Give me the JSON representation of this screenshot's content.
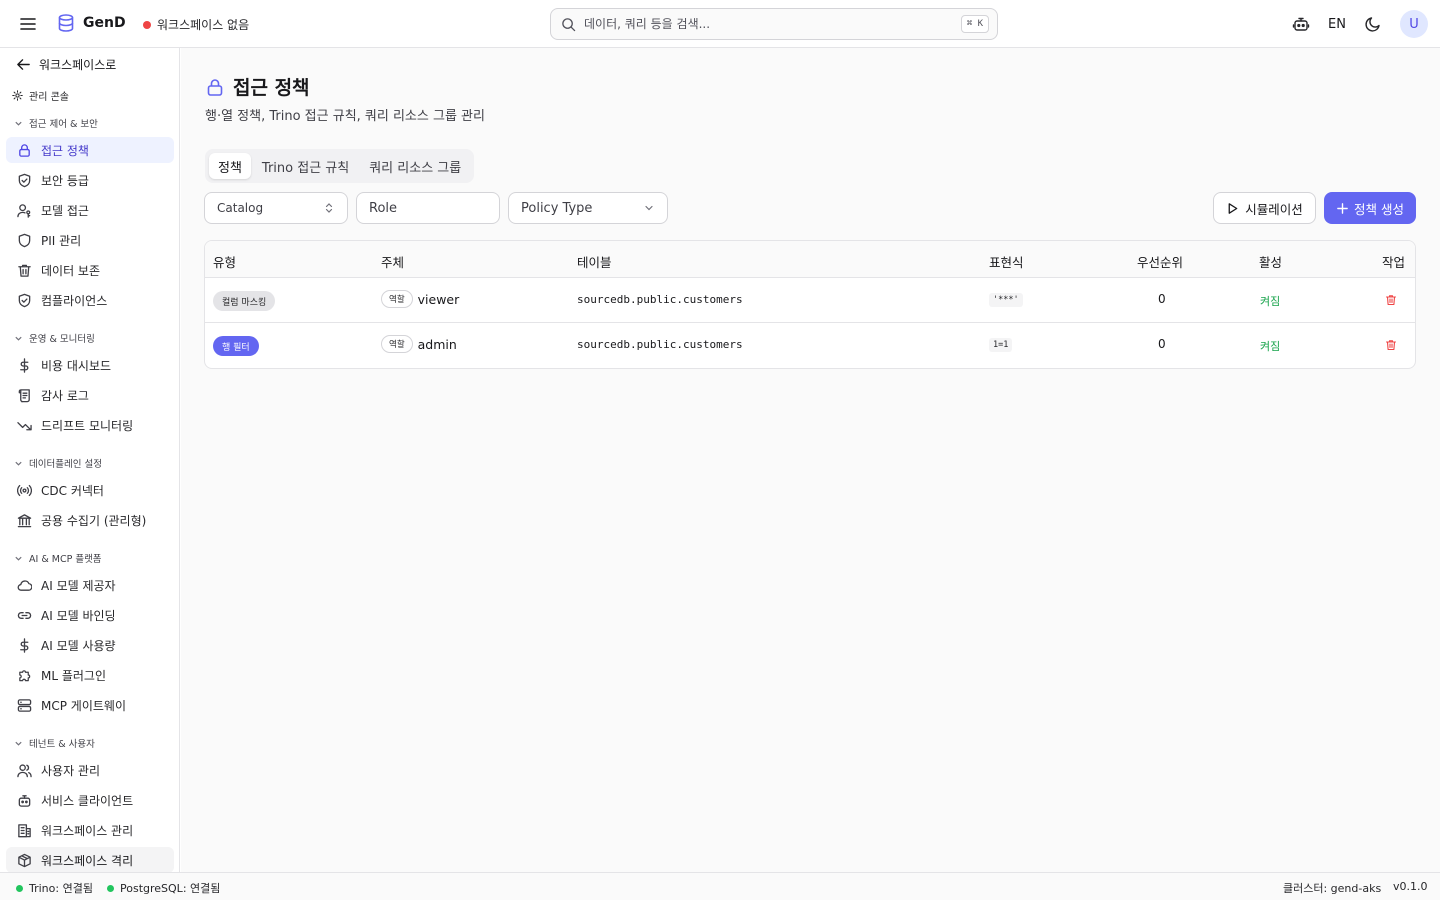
{
  "header": {
    "brand": "GenD",
    "workspace_status": "워크스페이스 없음",
    "search_placeholder": "데이터, 쿼리 등을 검색...",
    "search_shortcut": "⌘ K",
    "language": "EN",
    "avatar_initial": "U"
  },
  "sidebar": {
    "back_label": "워크스페이스로",
    "admin_label": "관리 콘솔",
    "sections": [
      {
        "title": "접근 제어 & 보안",
        "items": [
          "접근 정책",
          "보안 등급",
          "모델 접근",
          "PII 관리",
          "데이터 보존",
          "컴플라이언스"
        ]
      },
      {
        "title": "운영 & 모니터링",
        "items": [
          "비용 대시보드",
          "감사 로그",
          "드리프트 모니터링"
        ]
      },
      {
        "title": "데이터플레인 설정",
        "items": [
          "CDC 커넥터",
          "공용 수집기 (관리형)"
        ]
      },
      {
        "title": "AI & MCP 플랫폼",
        "items": [
          "AI 모델 제공자",
          "AI 모델 바인딩",
          "AI 모델 사용량",
          "ML 플러그인",
          "MCP 게이트웨이"
        ]
      },
      {
        "title": "테넌트 & 사용자",
        "items": [
          "사용자 관리",
          "서비스 클라이언트",
          "워크스페이스 관리",
          "워크스페이스 격리"
        ]
      }
    ]
  },
  "page": {
    "title": "접근 정책",
    "subtitle": "행·열 정책, Trino 접근 규칙, 쿼리 리소스 그룹 관리",
    "tabs": [
      "정책",
      "Trino 접근 규칙",
      "쿼리 리소스 그룹"
    ],
    "filters": {
      "catalog": "Catalog",
      "role_placeholder": "Role",
      "policy_type": "Policy Type"
    },
    "simulate_label": "시뮬레이션",
    "create_label": "정책 생성"
  },
  "table": {
    "columns": [
      "유형",
      "주체",
      "테이블",
      "표현식",
      "우선순위",
      "활성",
      "작업"
    ],
    "rows": [
      {
        "type": "컬럼 마스킹",
        "role_tag": "역할",
        "subject": "viewer",
        "table": "sourcedb.public.customers",
        "expression": "'***'",
        "priority": "0",
        "active": "켜짐"
      },
      {
        "type": "행 필터",
        "role_tag": "역할",
        "subject": "admin",
        "table": "sourcedb.public.customers",
        "expression": "1=1",
        "priority": "0",
        "active": "켜짐"
      }
    ]
  },
  "status": {
    "trino": "Trino: 연결됨",
    "postgres": "PostgreSQL: 연결됨",
    "cluster": "클러스터: gend-aks",
    "version": "v0.1.0"
  },
  "colors": {
    "accent": "#6366f1",
    "ok": "#22c55e",
    "danger": "#ef4444"
  }
}
